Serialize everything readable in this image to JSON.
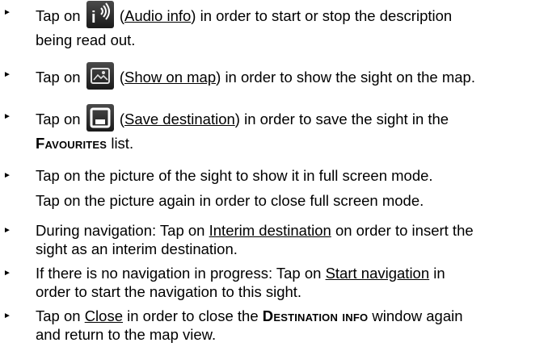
{
  "bullet_char": "►",
  "items": [
    {
      "tap_on": "Tap on",
      "link": "Audio info",
      "line1_after": "in order to start or stop the description",
      "line2": "being read out.",
      "icon": "audio-info-icon"
    },
    {
      "tap_on": "Tap on",
      "link": "Show on map",
      "after": "in order to show the sight on the map.",
      "icon": "show-on-map-icon"
    },
    {
      "tap_on": "Tap on",
      "link": "Save destination",
      "line1_after": "in order to save the sight in the",
      "line2_caps": "Favourites",
      "line2_after": "list.",
      "icon": "save-destination-icon"
    },
    {
      "line1": "Tap on the picture of the sight to show it in full screen mode.",
      "line2": "Tap on the picture again in order to close full screen mode."
    },
    {
      "line1_before": "During navigation: Tap on",
      "link": "Interim destination",
      "line1_after": "on order to insert the",
      "line2": "sight as an interim destination."
    },
    {
      "line1_before": "If there is no navigation in progress: Tap on",
      "link": "Start navigation",
      "line1_after": "in",
      "line2": "order to start the navigation to this sight."
    },
    {
      "line1_before": "Tap on",
      "link": "Close",
      "line1_mid": "in order to close the",
      "caps": "Destination info",
      "line1_after": "window again",
      "line2": "and return to the map view."
    }
  ]
}
